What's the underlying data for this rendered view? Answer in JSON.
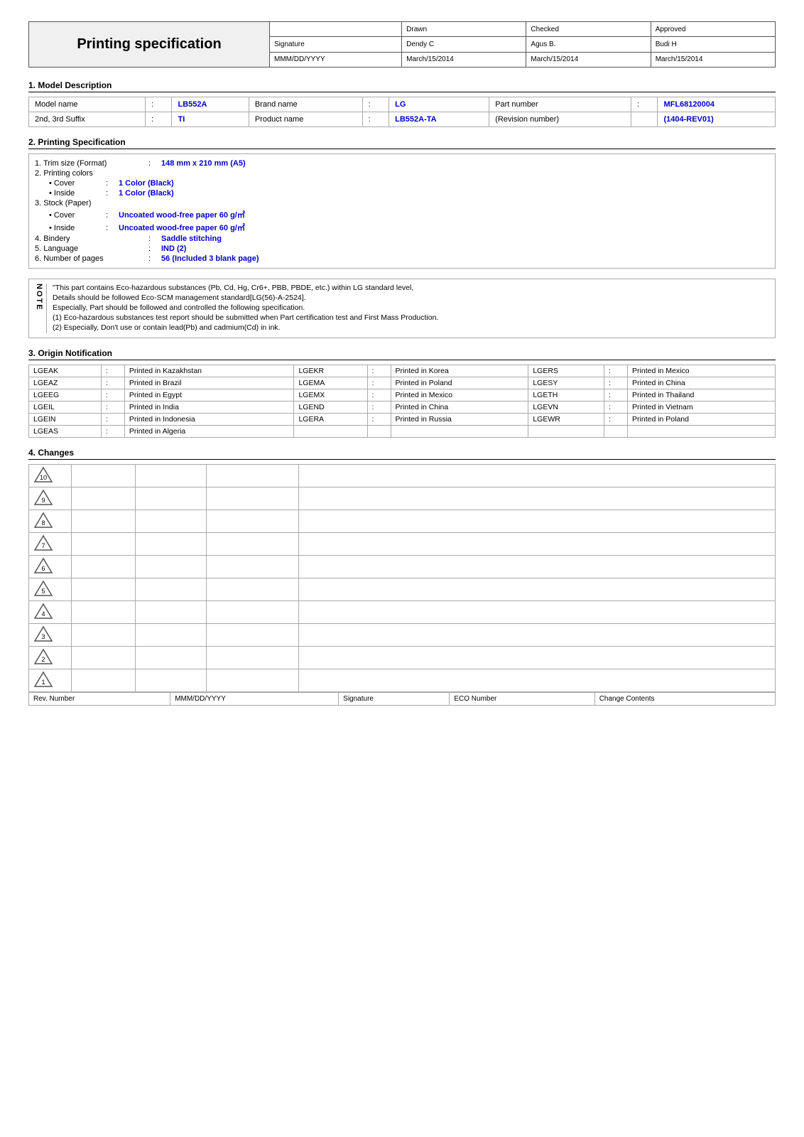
{
  "header": {
    "title": "Printing specification",
    "table": {
      "columns": [
        "",
        "Drawn",
        "Checked",
        "Approved"
      ],
      "rows": [
        [
          "Signature",
          "Dendy C",
          "Agus B.",
          "Budi H"
        ],
        [
          "MMM/DD/YYYY",
          "March/15/2014",
          "March/15/2014",
          "March/15/2014"
        ]
      ]
    }
  },
  "section1": {
    "title": "1. Model Description",
    "rows": [
      {
        "label": "Model name",
        "value": "LB552A",
        "label2": "Brand name",
        "value2": "LG",
        "label3": "Part number",
        "value3": "MFL68120004"
      },
      {
        "label": "2nd, 3rd Suffix",
        "value": "TI",
        "label2": "Product name",
        "value2": "LB552A-TA",
        "label3": "(Revision number)",
        "value3": "(1404-REV01)"
      }
    ]
  },
  "section2": {
    "title": "2. Printing Specification",
    "items": [
      {
        "label": "1. Trim size (Format)",
        "colon": ":",
        "value": "148 mm x 210 mm (A5)",
        "accent": true
      },
      {
        "label": "2. Printing colors",
        "colon": "",
        "value": "",
        "accent": false
      },
      {
        "sublabel": "• Cover",
        "subcolon": ":",
        "subvalue": "1 Color (Black)",
        "accent": true
      },
      {
        "sublabel": "• Inside",
        "subcolon": ":",
        "subvalue": "1 Color (Black)",
        "accent": true
      },
      {
        "label": "3. Stock (Paper)",
        "colon": "",
        "value": "",
        "accent": false
      },
      {
        "sublabel": "• Cover",
        "subcolon": ":",
        "subvalue": "Uncoated wood-free paper 60 g/㎡",
        "accent": true
      },
      {
        "sublabel": "• Inside",
        "subcolon": ":",
        "subvalue": "Uncoated wood-free paper 60 g/㎡",
        "accent": true
      },
      {
        "label": "4. Bindery",
        "colon": ":",
        "value": "Saddle stitching",
        "accent": true
      },
      {
        "label": "5. Language",
        "colon": ":",
        "value": "IND (2)",
        "accent": true
      },
      {
        "label": "6. Number of pages",
        "colon": ":",
        "value": "56 (Included 3 blank page)",
        "accent": true
      }
    ]
  },
  "notes": {
    "side_label": "NOTE",
    "items": [
      "\"This part contains Eco-hazardous substances (Pb, Cd, Hg, Cr6+, PBB, PBDE, etc.) within LG standard level,",
      "Details should be followed Eco-SCM management standard[LG(56)-A-2524].",
      "Especially, Part should be followed and controlled the following specification.",
      "(1) Eco-hazardous substances test report should be submitted when Part certification test and First Mass Production.",
      "(2) Especially, Don't use or contain lead(Pb) and cadmium(Cd) in ink."
    ]
  },
  "section3": {
    "title": "3. Origin Notification",
    "rows": [
      [
        {
          "code": "LGEAK",
          "country": "Printed in Kazakhstan"
        },
        {
          "code": "LGEKR",
          "country": "Printed in Korea"
        },
        {
          "code": "LGERS",
          "country": "Printed in Mexico"
        }
      ],
      [
        {
          "code": "LGEAZ",
          "country": "Printed in Brazil"
        },
        {
          "code": "LGEMA",
          "country": "Printed in Poland"
        },
        {
          "code": "LGESY",
          "country": "Printed in China"
        }
      ],
      [
        {
          "code": "LGEEG",
          "country": "Printed in Egypt"
        },
        {
          "code": "LGEMX",
          "country": "Printed in Mexico"
        },
        {
          "code": "LGETH",
          "country": "Printed in Thailand"
        }
      ],
      [
        {
          "code": "LGEIL",
          "country": "Printed in India"
        },
        {
          "code": "LGEND",
          "country": "Printed in China"
        },
        {
          "code": "LGEVN",
          "country": "Printed in Vietnam"
        }
      ],
      [
        {
          "code": "LGEIN",
          "country": "Printed in Indonesia"
        },
        {
          "code": "LGERA",
          "country": "Printed in Russia"
        },
        {
          "code": "LGEWR",
          "country": "Printed in Poland"
        }
      ],
      [
        {
          "code": "LGEAS",
          "country": "Printed in Algeria"
        },
        {
          "code": "",
          "country": ""
        },
        {
          "code": "",
          "country": ""
        }
      ]
    ]
  },
  "section4": {
    "title": "4. Changes",
    "revisions": [
      10,
      9,
      8,
      7,
      6,
      5,
      4,
      3,
      2,
      1
    ],
    "footer": {
      "col1": "Rev. Number",
      "col2": "MMM/DD/YYYY",
      "col3": "Signature",
      "col4": "ECO Number",
      "col5": "Change Contents"
    }
  }
}
